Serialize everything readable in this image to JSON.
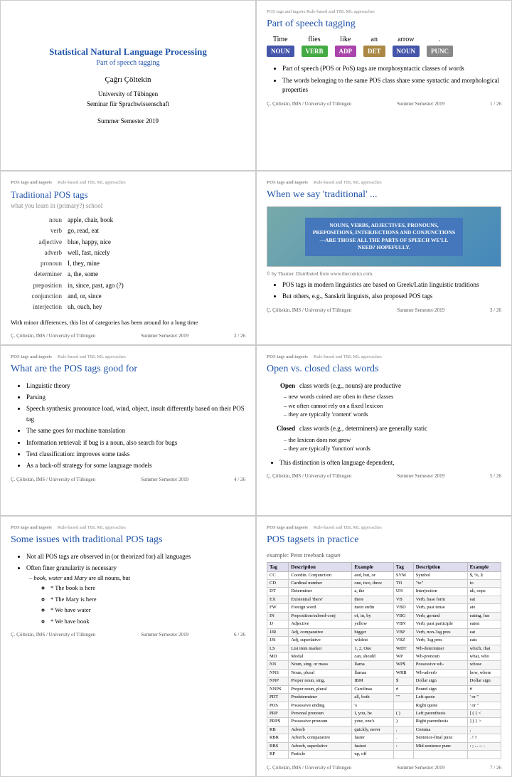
{
  "cover": {
    "title": "Statistical Natural Language Processing",
    "subtitle": "Part of speech tagging",
    "author": "Çağrı Çöltekin",
    "university": "University of Tübingen",
    "department": "Seminar für Sprachwissenschaft",
    "semester": "Summer Semester 2019"
  },
  "slide1": {
    "topbar": "POS tags and tagsets   Rule-based and TBL   ML approaches",
    "title": "Part of speech tagging",
    "sentence": {
      "words": [
        "Time",
        "flies",
        "like",
        "an",
        "arrow",
        "."
      ],
      "tags": [
        "NOUN",
        "VERB",
        "ADP",
        "DET",
        "NOUN",
        "PUNC"
      ]
    },
    "bullets": [
      "Part of speech (POS or PoS) tags are morphosyntactic classes of words",
      "The words belonging to the same POS class share some syntactic and morphological properties"
    ],
    "footer_left": "Ç. Çöltekin,   IMS / University of Tübingen",
    "footer_right": "Summer Semester 2019",
    "page": "1 / 26"
  },
  "slide2": {
    "topbar_main": "POS tags and tagsets",
    "topbar_rest": "Rule-based and TBL   ML approaches",
    "title": "Traditional POS tags",
    "subtitle": "what you learn in (primary?) school",
    "categories": [
      {
        "cat": "noun",
        "examples": "apple, chair, book"
      },
      {
        "cat": "verb",
        "examples": "go, read, eat"
      },
      {
        "cat": "adjective",
        "examples": "blue, happy, nice"
      },
      {
        "cat": "adverb",
        "examples": "well, fast, nicely"
      },
      {
        "cat": "pronoun",
        "examples": "I, they, mine"
      },
      {
        "cat": "determiner",
        "examples": "a, the, some"
      },
      {
        "cat": "preposition",
        "examples": "in, since, past, ago (?)"
      },
      {
        "cat": "conjunction",
        "examples": "and, or, since"
      },
      {
        "cat": "interjection",
        "examples": "uh, ouch, hey"
      }
    ],
    "note": "With minor differences, this list of categories has been around for a long time",
    "footer_left": "Ç. Çöltekin,   IMS / University of Tübingen",
    "footer_right": "Summer Semester 2019",
    "page": "2 / 26"
  },
  "slide3": {
    "topbar_main": "POS tags and tagsets",
    "topbar_rest": "Rule-based and TBL   ML approaches",
    "title": "When we say 'traditional' ...",
    "cartoon_text": "NOUNS, VERBS, ADJECTIVES, PRONOUNS, PREPOSITIONS, INTERJECTIONS AND CONJUNCTIONS—ARE THOSE ALL THE PARTS OF SPEECH WE'LL NEED? HOPEFULLY.",
    "cartoon_caption": "© by Tharner. Distributed from www.thecomics.com",
    "bullets": [
      "POS tags in modern linguistics are based on Greek/Latin linguistic traditions",
      "But others, e.g., Sanskrit linguists, also proposed POS tags"
    ],
    "footer_left": "Ç. Çöltekin,   IMS / University of Tübingen",
    "footer_right": "Summer Semester 2019",
    "page": "3 / 26"
  },
  "slide4": {
    "topbar_main": "POS tags and tagsets",
    "topbar_rest": "Rule-based and TBL   ML approaches",
    "title": "What are the POS tags good for",
    "bullets": [
      "Linguistic theory",
      "Parsing",
      "Speech synthesis: pronounce load, wind, object, insult differently based on their POS tag",
      "The same goes for machine translation",
      "Information retrieval: if bug is a noun, also search for bugs",
      "Text classification: improves some tasks",
      "As a back-off strategy for some language models"
    ],
    "footer_left": "Ç. Çöltekin,   IMS / University of Tübingen",
    "footer_right": "Summer Semester 2019",
    "page": "4 / 26"
  },
  "slide5": {
    "topbar_main": "POS tags and tagsets",
    "topbar_rest": "Rule-based and TBL   ML approaches",
    "title": "Open vs. closed class words",
    "open_label": "Open",
    "open_text": "class words (e.g., nouns) are productive",
    "open_subs": [
      "new words coined are often in these classes",
      "we often cannot rely on a fixed lexicon",
      "they are typically 'content' words"
    ],
    "closed_label": "Closed",
    "closed_text": "class words (e.g., determiners) are generally static",
    "closed_subs": [
      "the lexicon does not grow",
      "they are typically 'function' words"
    ],
    "extra_bullet": "This distinction is often language dependent,",
    "footer_left": "Ç. Çöltekin,   IMS / University of Tübingen",
    "footer_right": "Summer Semester 2019",
    "page": "5 / 26"
  },
  "slide6": {
    "topbar_main": "POS tags and tagsets",
    "topbar_rest": "Rule-based and TBL   ML approaches",
    "title": "Some issues with traditional POS tags",
    "bullets": [
      "Not all POS tags are observed in (or theorized for) all languages",
      "Often finer granularity is necessary"
    ],
    "sub_intro": "book, water and Mary are all nouns, but",
    "sub_items": [
      "The book is here",
      "The Mary is here",
      "We have water",
      "We have book"
    ],
    "footer_left": "Ç. Çöltekin,   IMS / University of Tübingen",
    "footer_right": "Summer Semester 2019",
    "page": "6 / 26"
  },
  "slide7": {
    "topbar_main": "POS tags and tagsets",
    "topbar_rest": "Rule-based and TBL   ML approaches",
    "title": "POS tagsets in practice",
    "subtitle": "example: Penn treebank tagset",
    "table_headers": [
      "Tag",
      "Description",
      "Example",
      "Tag",
      "Description",
      "Example"
    ],
    "table_rows": [
      [
        "CC",
        "Coordin. Conjunction",
        "and, but, or",
        "SYM",
        "Symbol",
        "$, %, §"
      ],
      [
        "CD",
        "Cardinal number",
        "one, two, three",
        "TO",
        "\"to\"",
        "to"
      ],
      [
        "DT",
        "Determiner",
        "a, the",
        "UH",
        "Interjection",
        "uh, oops"
      ],
      [
        "EX",
        "Existential 'there'",
        "there",
        "VB",
        "Verb, base form",
        "eat"
      ],
      [
        "FW",
        "Foreign word",
        "mein enfin",
        "VBD",
        "Verb, past tense",
        "ate"
      ],
      [
        "IN",
        "Preposition/subord-conj",
        "of, in, by",
        "VBG",
        "Verb, gerund",
        "eating, fun"
      ],
      [
        "JJ",
        "Adjective",
        "yellow",
        "VBN",
        "Verb, past participle",
        "eaten"
      ],
      [
        "JJR",
        "Adj, comparative",
        "bigger",
        "VBP",
        "Verb, non-3sg pres",
        "eat"
      ],
      [
        "JJS",
        "Adj, superlative",
        "wildest",
        "VBZ",
        "Verb, 3sg pres",
        "eats"
      ],
      [
        "LS",
        "List item marker",
        "1, 2, One",
        "WDT",
        "Wh-determiner",
        "which, that"
      ],
      [
        "MD",
        "Modal",
        "can, should",
        "WP",
        "Wh-pronoun",
        "what, who"
      ],
      [
        "NN",
        "Noun, sing. or mass",
        "llama",
        "WP$",
        "Possessive wh-",
        "whose"
      ],
      [
        "NNS",
        "Noun, plural",
        "llamas",
        "WRB",
        "Wh-adverb",
        "how, where"
      ],
      [
        "NNP",
        "Proper noun, sing.",
        "IBM",
        "$",
        "Dollar sign",
        "Dollar sign"
      ],
      [
        "NNPS",
        "Proper noun, plural",
        "Carolinas",
        "#",
        "Pound sign",
        "#"
      ],
      [
        "PDT",
        "Predeterminer",
        "all, both",
        "\"\"",
        "Left quote",
        "' or \""
      ],
      [
        "POS",
        "Possessive ending",
        "'s",
        "",
        "Right quote",
        "' or \""
      ],
      [
        "PRP",
        "Personal pronoun",
        "I, you, he",
        "( )",
        "Left parenthesis",
        "[ ( { <"
      ],
      [
        "PRP$",
        "Possessive pronoun",
        "your, one's",
        ")",
        "Right parenthesis",
        "] ) } >"
      ],
      [
        "RB",
        "Adverb",
        "quickly, never",
        ",",
        "Comma",
        ","
      ],
      [
        "RBR",
        "Adverb, comparative",
        "faster",
        ".",
        "Sentence-final punc",
        ". ! ?"
      ],
      [
        "RBS",
        "Adverb, superlative",
        "fastest",
        ":",
        "Mid-sentence punc",
        ": ; ... -- -"
      ],
      [
        "RP",
        "Particle",
        "up, off",
        "",
        "",
        ""
      ]
    ],
    "footer_left": "Ç. Çöltekin,   IMS / University of Tübingen",
    "footer_right": "Summer Semester 2019",
    "page": "7 / 26"
  }
}
